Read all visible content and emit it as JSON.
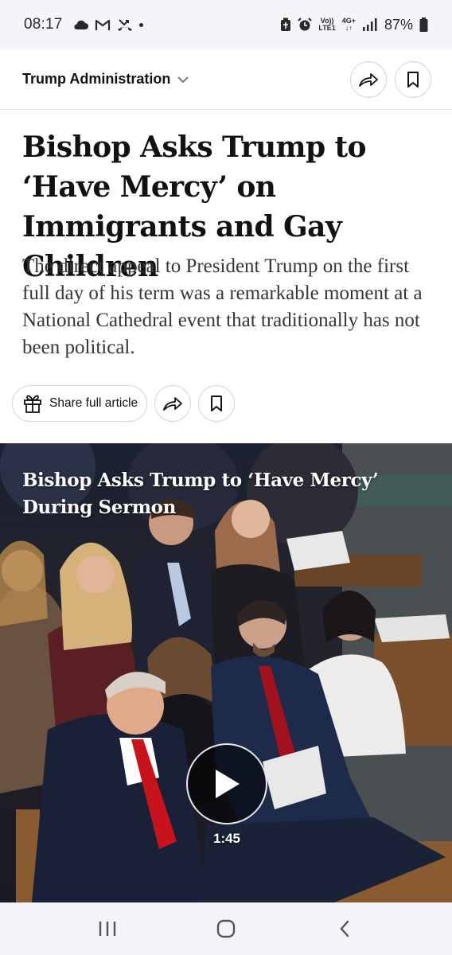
{
  "status_bar": {
    "time": "08:17",
    "network_top": "Vo))",
    "network_bottom": "LTE1",
    "gen_top": "4G+",
    "gen_bottom": "↓↑",
    "battery": "87%"
  },
  "header": {
    "section": "Trump Administration"
  },
  "article": {
    "headline": "Bishop Asks Trump to ‘Have Mercy’ on Immigrants and Gay Children",
    "summary": "The direct appeal to President Trump on the first full day of his term was a remarkable moment at a National Cathedral event that traditionally has not been political.",
    "share_full_label": "Share full article"
  },
  "video": {
    "title": "Bishop Asks Trump to ‘Have Mercy’ During Sermon",
    "duration": "1:45"
  },
  "icons": {
    "share": "share-arrow-icon",
    "bookmark": "bookmark-icon",
    "gift": "gift-icon",
    "play": "play-icon"
  },
  "colors": {
    "status_bar_bg": "#f4f5f9",
    "text_primary": "#121212",
    "text_secondary": "#363636"
  }
}
